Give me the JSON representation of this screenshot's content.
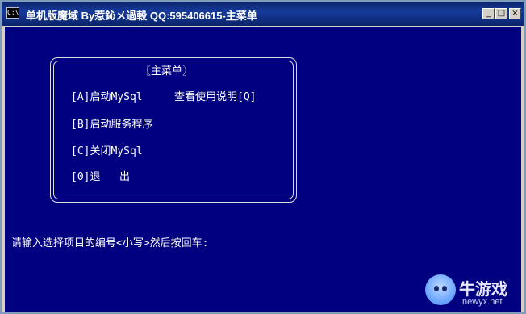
{
  "window": {
    "title": "单机版魔域 By惹鈊メ過軗 QQ:595406615-主菜单"
  },
  "menu": {
    "heading": "〖主菜单〗",
    "items": [
      {
        "label": "[A]启动MySql"
      },
      {
        "label": "查看使用说明[Q]"
      },
      {
        "label": "[B]启动服务程序"
      },
      {
        "label": "[C]关闭MySql"
      },
      {
        "label": "[0]退   出"
      }
    ]
  },
  "prompt": "请输入选择项目的编号<小写>然后按回车:",
  "watermark": {
    "brand": "牛游戏",
    "url": "newyx.net"
  },
  "colors": {
    "console_bg": "#000080",
    "titlebar": "#0a246a",
    "text": "#ffffff"
  }
}
